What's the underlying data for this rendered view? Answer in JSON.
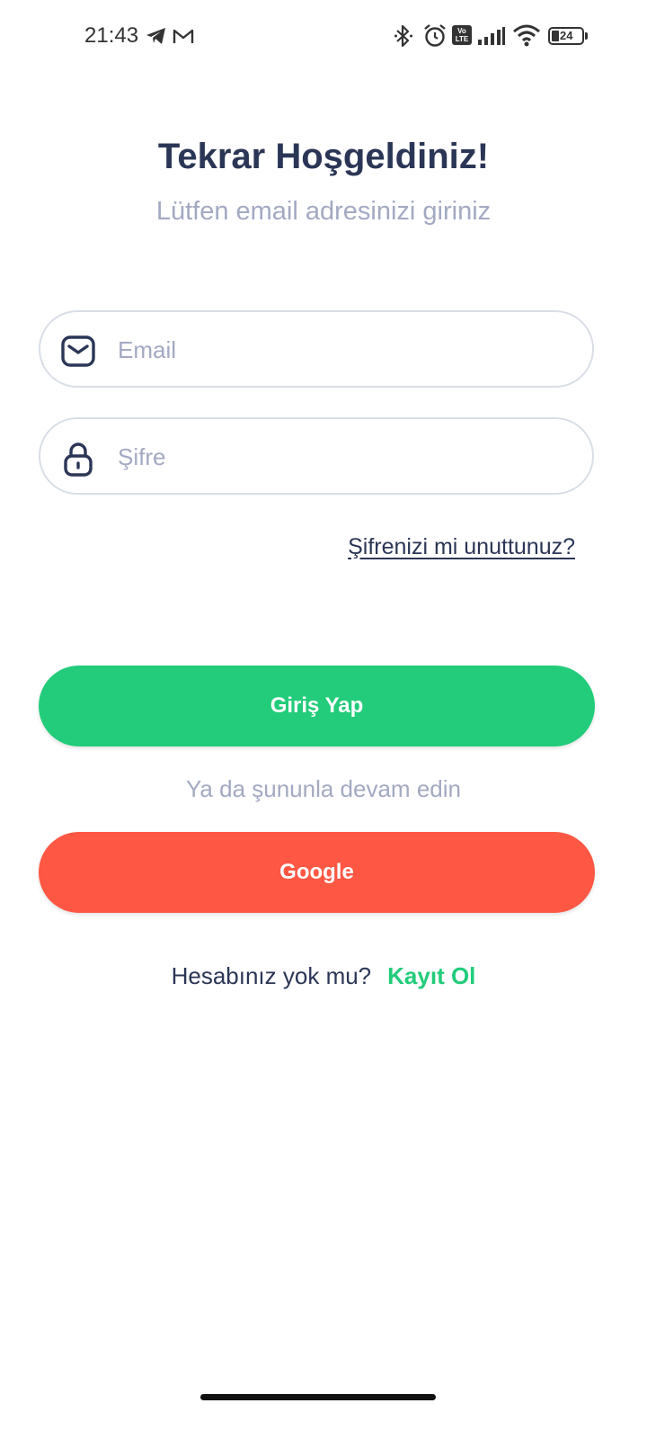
{
  "status_bar": {
    "time": "21:43",
    "left_icons": [
      "telegram-icon",
      "gmail-icon"
    ],
    "right_icons": [
      "bluetooth-icon",
      "alarm-icon",
      "volte-icon",
      "signal-icon",
      "wifi-icon",
      "battery-icon"
    ],
    "volte_label": "Vo LTE",
    "battery_level": "24"
  },
  "header": {
    "title": "Tekrar Hoşgeldiniz!",
    "subtitle": "Lütfen email adresinizi giriniz"
  },
  "form": {
    "email": {
      "icon": "mail-icon",
      "placeholder": "Email",
      "value": ""
    },
    "password": {
      "icon": "lock-icon",
      "placeholder": "Şifre",
      "value": ""
    },
    "forgot_label": "Şifrenizi mi unuttunuz?"
  },
  "actions": {
    "login_label": "Giriş Yap",
    "divider_label": "Ya da şununla devam edin",
    "google_label": "Google"
  },
  "signup": {
    "question": "Hesabınız yok mu?",
    "link_label": "Kayıt Ol"
  },
  "colors": {
    "primary": "#22cc7a",
    "google": "#fe5743",
    "heading": "#2b3656",
    "muted": "#a3a9c2",
    "border": "#d9dee6"
  }
}
